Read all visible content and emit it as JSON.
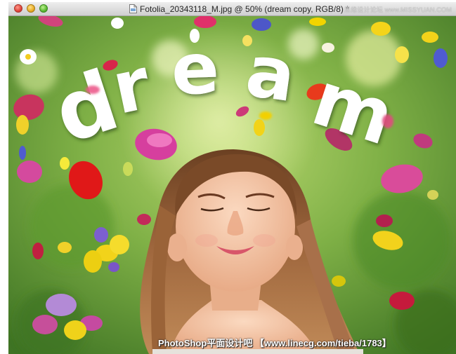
{
  "window": {
    "title": "Fotolia_20343118_M.jpg @ 50% (dream copy, RGB/8) *",
    "title_icon": "document-icon",
    "controls": [
      "close",
      "minimize",
      "zoom"
    ]
  },
  "watermark_top": "思缘设计论坛 www.MISSYUAN.COM",
  "artwork": {
    "text": "dream"
  },
  "caption": "PhotoShop平面设计吧 【www.linecg.com/tieba/1783】",
  "colors": {
    "grass": "#6fa53b",
    "text_fill": "#ffffff",
    "hair": "#8a5a36",
    "skin": "#f2c2a2"
  }
}
